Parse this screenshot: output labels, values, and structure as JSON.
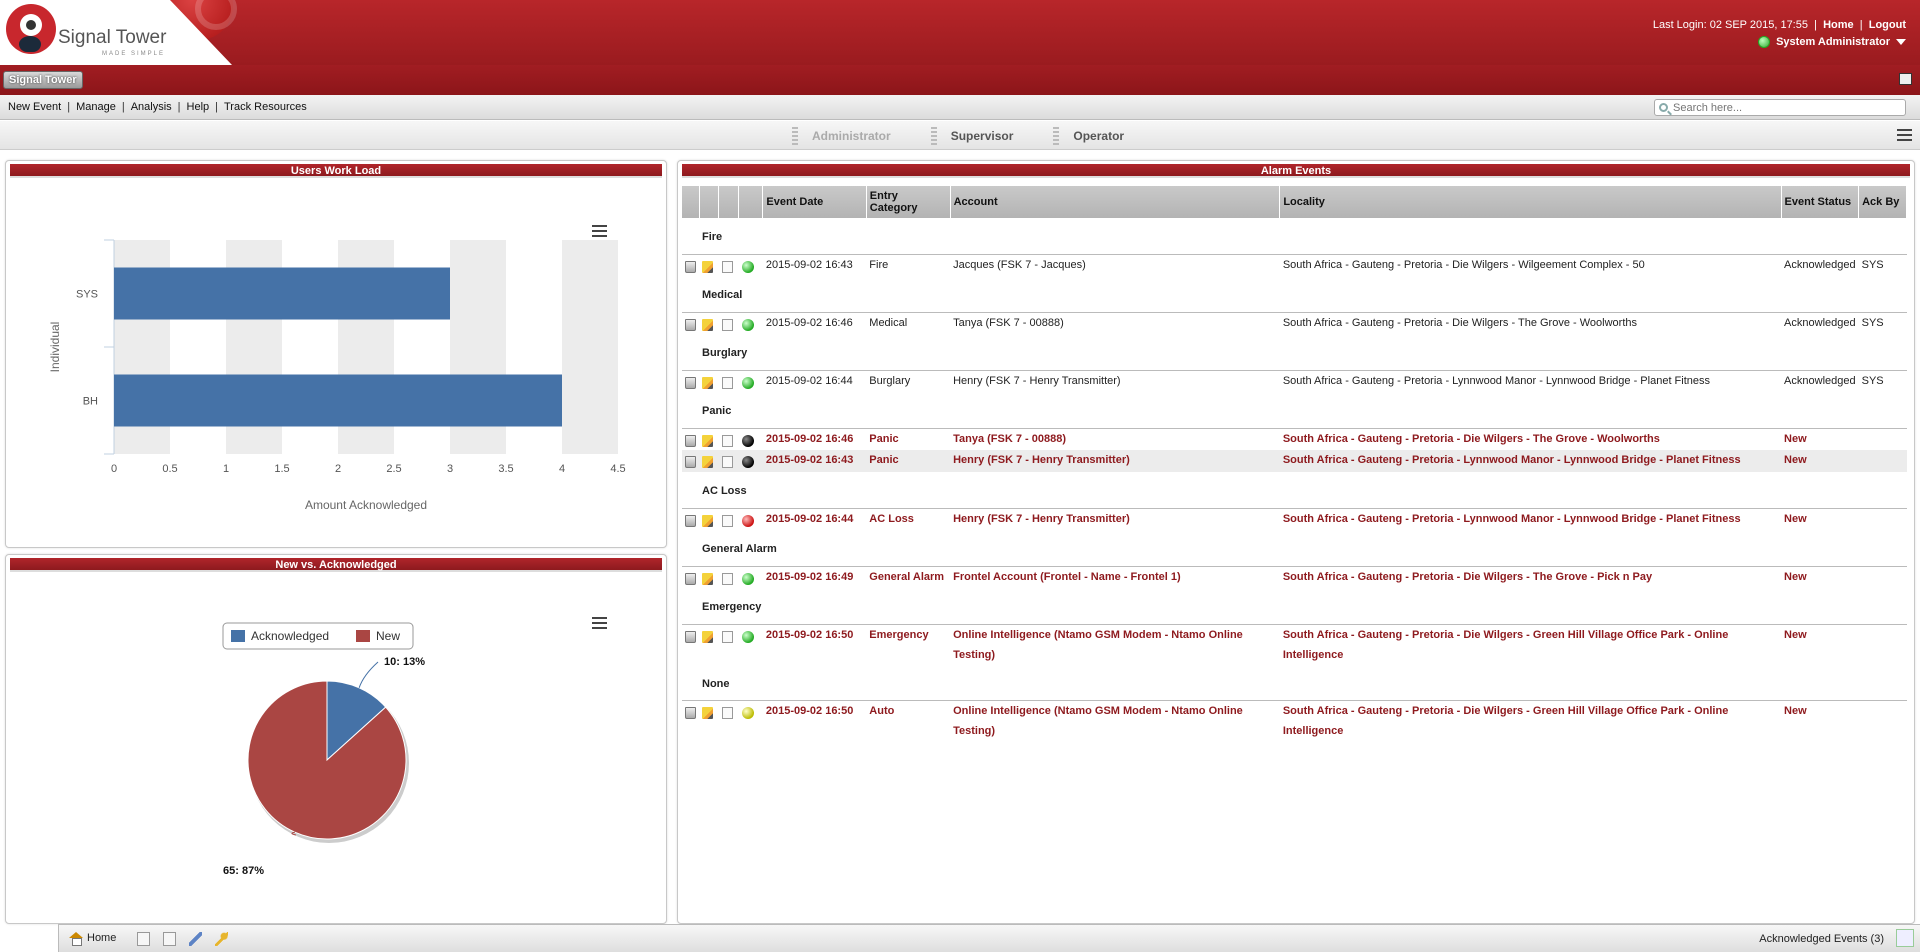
{
  "header": {
    "brand": "Signal Tower",
    "tagline": "MADE SIMPLE",
    "last_login": "Last Login: 02 SEP 2015, 17:55",
    "home_link": "Home",
    "logout_link": "Logout",
    "user_name": "System Administrator"
  },
  "appbar": {
    "app_button": "Signal Tower"
  },
  "menu": {
    "items": [
      "New Event",
      "Manage",
      "Analysis",
      "Help",
      "Track Resources"
    ],
    "search_placeholder": "Search here..."
  },
  "roles": [
    "Administrator",
    "Supervisor",
    "Operator"
  ],
  "workload_panel": {
    "title": "Users Work Load"
  },
  "pie_panel": {
    "title": "New vs. Acknowledged"
  },
  "chart_data": [
    {
      "type": "bar",
      "orientation": "horizontal",
      "categories": [
        "SYS",
        "BH"
      ],
      "values": [
        3,
        4
      ],
      "xlabel": "Amount Acknowledged",
      "ylabel": "Individual",
      "xlim": [
        0,
        4.5
      ],
      "ticks": [
        "0",
        "0.5",
        "1",
        "1.5",
        "2",
        "2.5",
        "3",
        "3.5",
        "4",
        "4.5"
      ],
      "bar_color": "#4572a7"
    },
    {
      "type": "pie",
      "legend": [
        "Acknowledged",
        "New"
      ],
      "slices": [
        {
          "name": "Acknowledged",
          "value": 10,
          "percent": 13,
          "label": "10: 13%",
          "color": "#4572a7"
        },
        {
          "name": "New",
          "value": 65,
          "percent": 87,
          "label": "65: 87%",
          "color": "#aa4643"
        }
      ]
    }
  ],
  "alarms": {
    "title": "Alarm Events",
    "columns": [
      "Event Date",
      "Entry Category",
      "Account",
      "Locality",
      "Event Status",
      "Ack By"
    ],
    "groups": [
      {
        "category": "Fire",
        "events": [
          {
            "date": "2015-09-02 16:43",
            "entry": "Fire",
            "account": "Jacques (FSK 7 - Jacques)",
            "locality": "South Africa - Gauteng - Pretoria - Die Wilgers - Wilgeement Complex - 50",
            "status": "Acknowledged",
            "ack_by": "SYS",
            "light": "green",
            "new": false
          }
        ]
      },
      {
        "category": "Medical",
        "events": [
          {
            "date": "2015-09-02 16:46",
            "entry": "Medical",
            "account": "Tanya (FSK 7 - 00888)",
            "locality": "South Africa - Gauteng - Pretoria - Die Wilgers - The Grove - Woolworths",
            "status": "Acknowledged",
            "ack_by": "SYS",
            "light": "green",
            "new": false
          }
        ]
      },
      {
        "category": "Burglary",
        "events": [
          {
            "date": "2015-09-02 16:44",
            "entry": "Burglary",
            "account": "Henry (FSK 7 - Henry Transmitter)",
            "locality": "South Africa - Gauteng - Pretoria - Lynnwood Manor - Lynnwood Bridge - Planet Fitness",
            "status": "Acknowledged",
            "ack_by": "SYS",
            "light": "green",
            "new": false
          }
        ]
      },
      {
        "category": "Panic",
        "events": [
          {
            "date": "2015-09-02 16:46",
            "entry": "Panic",
            "account": "Tanya (FSK 7 - 00888)",
            "locality": "South Africa - Gauteng - Pretoria - Die Wilgers - The Grove - Woolworths",
            "status": "New",
            "ack_by": "",
            "light": "black",
            "new": true
          },
          {
            "date": "2015-09-02 16:43",
            "entry": "Panic",
            "account": "Henry (FSK 7 - Henry Transmitter)",
            "locality": "South Africa - Gauteng - Pretoria - Lynnwood Manor - Lynnwood Bridge - Planet Fitness",
            "status": "New",
            "ack_by": "",
            "light": "black",
            "new": true
          }
        ]
      },
      {
        "category": "AC Loss",
        "events": [
          {
            "date": "2015-09-02 16:44",
            "entry": "AC Loss",
            "account": "Henry (FSK 7 - Henry Transmitter)",
            "locality": "South Africa - Gauteng - Pretoria - Lynnwood Manor - Lynnwood Bridge - Planet Fitness",
            "status": "New",
            "ack_by": "",
            "light": "red",
            "new": true
          }
        ]
      },
      {
        "category": "General Alarm",
        "events": [
          {
            "date": "2015-09-02 16:49",
            "entry": "General Alarm",
            "account": "Frontel Account (Frontel - Name - Frontel 1)",
            "locality": "South Africa - Gauteng - Pretoria - Die Wilgers - The Grove - Pick n Pay",
            "status": "New",
            "ack_by": "",
            "light": "green",
            "new": true
          }
        ]
      },
      {
        "category": "Emergency",
        "events": [
          {
            "date": "2015-09-02 16:50",
            "entry": "Emergency",
            "account": "Online Intelligence (Ntamo GSM Modem - Ntamo Online Testing)",
            "locality": "South Africa - Gauteng - Pretoria - Die Wilgers - Green Hill Village Office Park - Online Intelligence",
            "status": "New",
            "ack_by": "",
            "light": "green",
            "new": true
          }
        ]
      },
      {
        "category": "None",
        "events": [
          {
            "date": "2015-09-02 16:50",
            "entry": "Auto",
            "account": "Online Intelligence (Ntamo GSM Modem - Ntamo Online Testing)",
            "locality": "South Africa - Gauteng - Pretoria - Die Wilgers - Green Hill Village Office Park - Online Intelligence",
            "status": "New",
            "ack_by": "",
            "light": "yellow",
            "new": true
          }
        ]
      }
    ]
  },
  "bottombar": {
    "home": "Home",
    "ack_events": "Acknowledged Events (3)"
  }
}
